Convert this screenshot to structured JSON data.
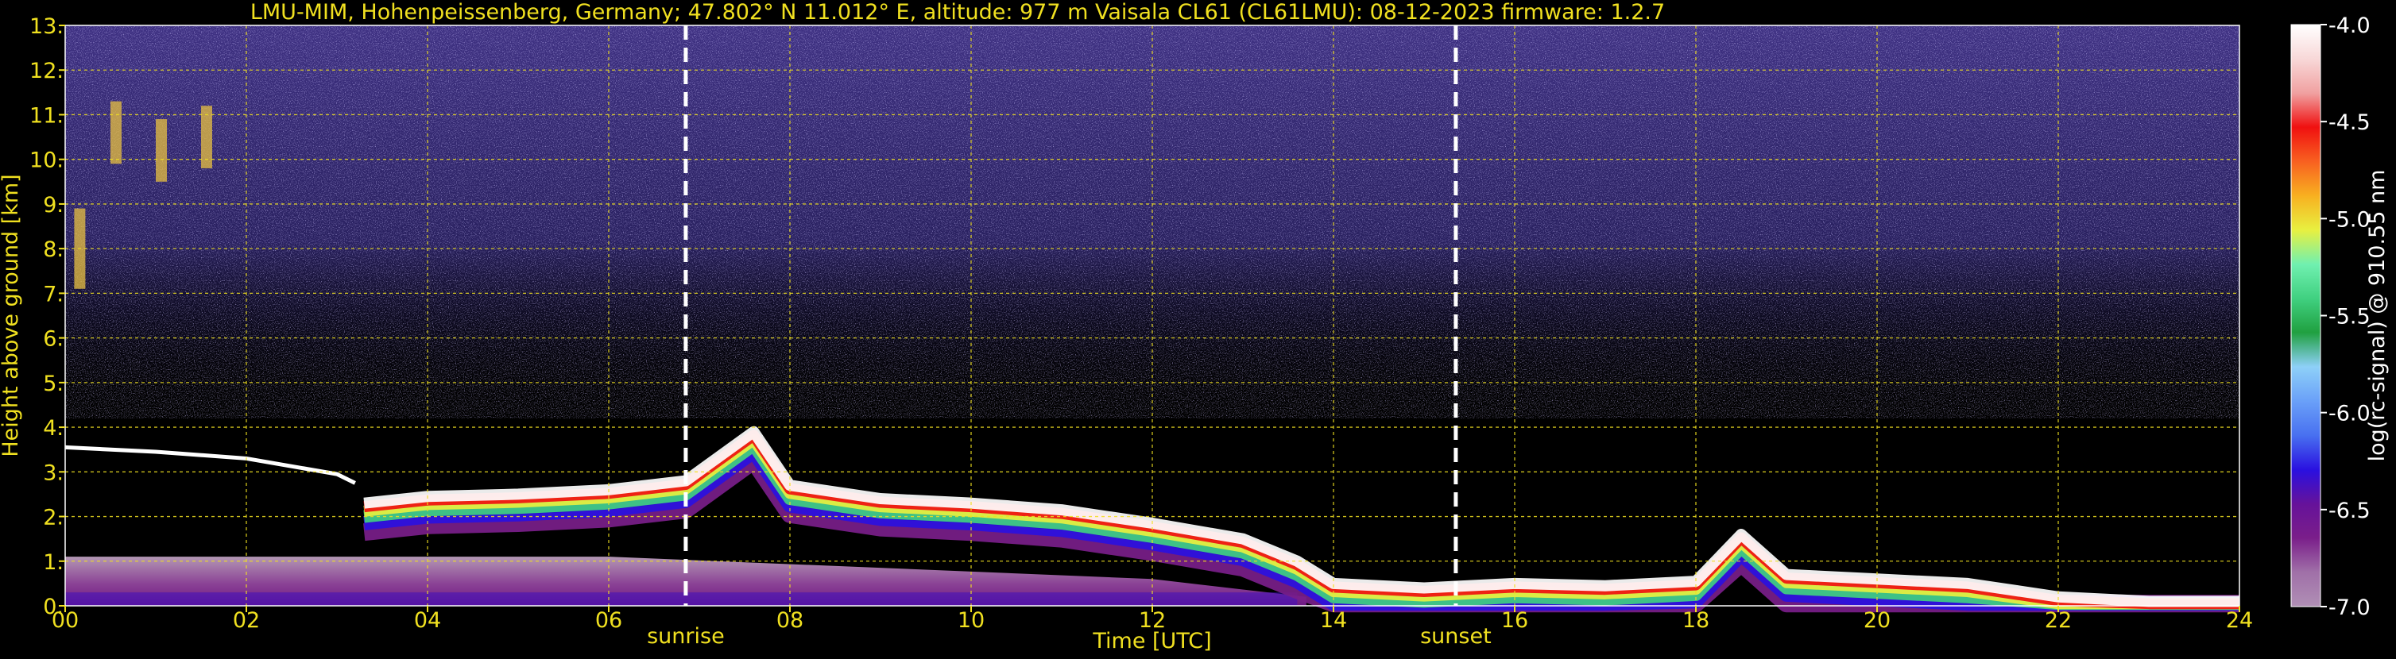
{
  "chart_data": {
    "type": "heatmap",
    "title": "LMU-MIM, Hohenpeissenberg, Germany; 47.802° N 11.012° E, altitude: 977 m    Vaisala CL61 (CL61LMU): 08-12-2023    firmware: 1.2.7",
    "xlabel": "Time [UTC]",
    "ylabel": "Height above ground [km]",
    "colorbar_label": "log(rc-signal) @ 910.55 nm",
    "xlim": [
      0,
      24
    ],
    "ylim": [
      0,
      13
    ],
    "x_ticks": [
      "00",
      "02",
      "04",
      "06",
      "08",
      "10",
      "12",
      "14",
      "16",
      "18",
      "20",
      "22",
      "24"
    ],
    "x_tick_values": [
      0,
      2,
      4,
      6,
      8,
      10,
      12,
      14,
      16,
      18,
      20,
      22,
      24
    ],
    "y_ticks": [
      "0.",
      "1.",
      "2.",
      "3.",
      "4.",
      "5.",
      "6.",
      "7.",
      "8.",
      "9.",
      "10.",
      "11.",
      "12.",
      "13."
    ],
    "y_tick_values": [
      0,
      1,
      2,
      3,
      4,
      5,
      6,
      7,
      8,
      9,
      10,
      11,
      12,
      13
    ],
    "grid": true,
    "colorbar": {
      "ticks": [
        "-4.0",
        "-4.5",
        "-5.0",
        "-5.5",
        "-6.0",
        "-6.5",
        "-7.0"
      ],
      "tick_values": [
        -4.0,
        -4.5,
        -5.0,
        -5.5,
        -6.0,
        -6.5,
        -7.0
      ],
      "range": [
        -7.0,
        -4.0
      ],
      "colors": [
        "#b08fb5",
        "#a070a8",
        "#7a1e8a",
        "#66129a",
        "#2a10e0",
        "#4870f0",
        "#6aa0f8",
        "#8ed0f8",
        "#20a040",
        "#40d080",
        "#70f0b0",
        "#e8f040",
        "#f8b020",
        "#f86020",
        "#f01010",
        "#f0a0a0",
        "#f8d8d8",
        "#ffffff"
      ]
    },
    "annotations": [
      {
        "label": "sunrise",
        "x": 6.85
      },
      {
        "label": "sunset",
        "x": 15.35
      }
    ],
    "layers": [
      {
        "name": "cloud_layer_1",
        "x": [
          0.0,
          1.0,
          2.0,
          3.0,
          3.2
        ],
        "y": [
          3.55,
          3.45,
          3.3,
          2.95,
          2.75
        ]
      },
      {
        "name": "boundary_layer_top",
        "x": [
          3.3,
          4.0,
          5.0,
          6.0,
          6.85,
          7.6,
          8.0,
          9.0,
          10.0,
          11.0,
          12.0,
          13.0,
          13.6,
          14.0,
          15.0,
          16.0,
          17.0,
          18.0,
          18.5,
          19.0,
          20.0,
          21.0,
          22.0,
          23.0,
          24.0
        ],
        "y": [
          2.3,
          2.45,
          2.5,
          2.6,
          2.8,
          3.9,
          2.7,
          2.4,
          2.3,
          2.15,
          1.85,
          1.5,
          1.0,
          0.5,
          0.4,
          0.5,
          0.45,
          0.55,
          1.6,
          0.7,
          0.6,
          0.5,
          0.2,
          0.1,
          0.1
        ]
      },
      {
        "name": "cirrus_early",
        "x": [
          0.1,
          0.5,
          1.0,
          1.5
        ],
        "y": [
          8.0,
          10.6,
          10.2,
          10.5
        ]
      },
      {
        "name": "surface_aerosol",
        "x": [
          0,
          6,
          12,
          13.7
        ],
        "y": [
          1.1,
          1.1,
          0.6,
          0.2
        ]
      }
    ]
  }
}
